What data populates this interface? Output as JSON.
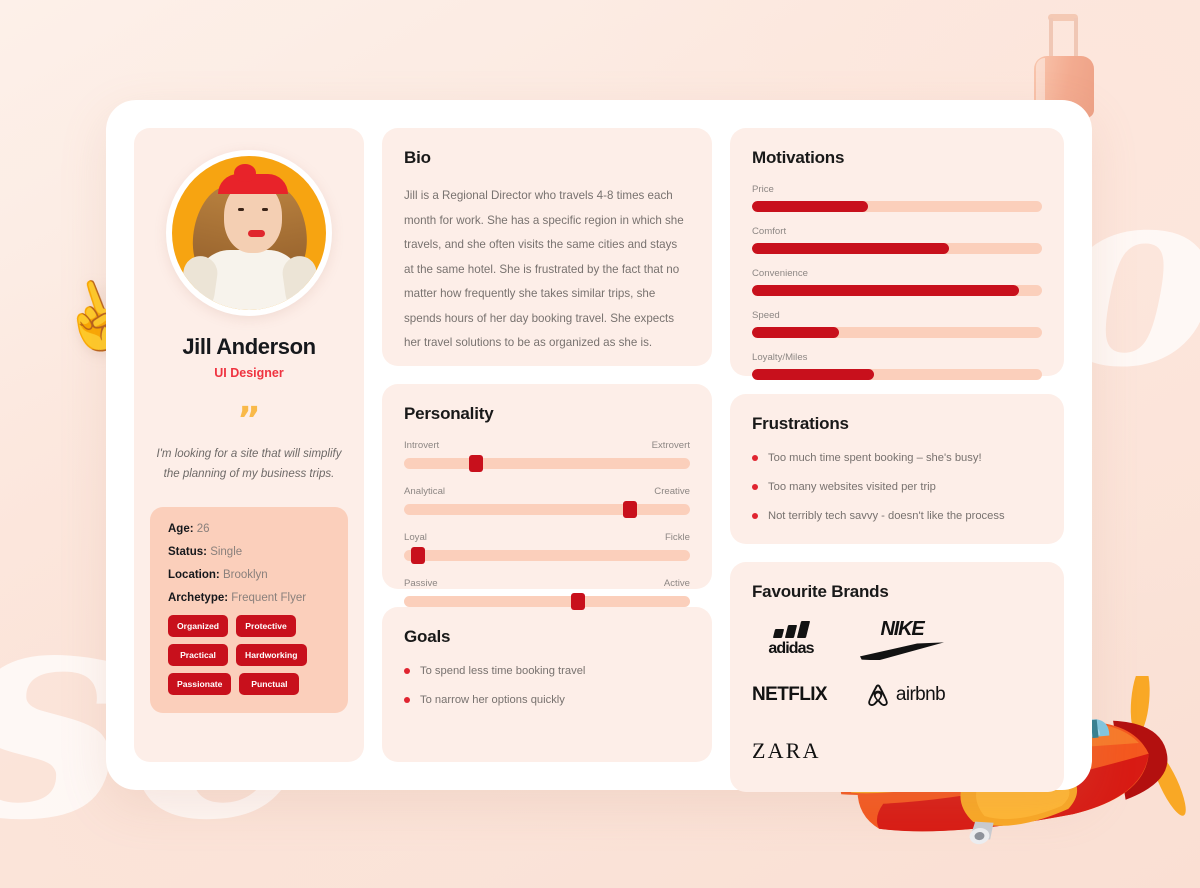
{
  "profile": {
    "name": "Jill Anderson",
    "role": "UI Designer",
    "quote_mark": "”",
    "quote": "I'm looking for a site that will simplify the planning of my business trips.",
    "facts": [
      {
        "label": "Age:",
        "value": "26"
      },
      {
        "label": "Status:",
        "value": "Single"
      },
      {
        "label": "Location:",
        "value": "Brooklyn"
      },
      {
        "label": "Archetype:",
        "value": "Frequent Flyer"
      }
    ],
    "chips": [
      "Organized",
      "Protective",
      "Practical",
      "Hardworking",
      "Passionate",
      "Punctual"
    ]
  },
  "bio": {
    "title": "Bio",
    "text": "Jill is a Regional Director who travels 4-8 times each month for work. She has a specific region in which she travels, and she often visits the same cities and stays at the same hotel. She is frustrated by the fact that no matter how frequently she takes similar trips, she spends hours of her day booking travel. She expects her travel solutions to be as organized as she is."
  },
  "personality": {
    "title": "Personality",
    "sliders": [
      {
        "left": "Introvert",
        "right": "Extrovert",
        "value": 25
      },
      {
        "left": "Analytical",
        "right": "Creative",
        "value": 79
      },
      {
        "left": "Loyal",
        "right": "Fickle",
        "value": 5
      },
      {
        "left": "Passive",
        "right": "Active",
        "value": 61
      }
    ]
  },
  "goals": {
    "title": "Goals",
    "items": [
      "To spend less time booking travel",
      "To narrow her options quickly"
    ]
  },
  "motivations": {
    "title": "Motivations",
    "items": [
      {
        "label": "Price",
        "value": 40
      },
      {
        "label": "Comfort",
        "value": 68
      },
      {
        "label": "Convenience",
        "value": 92
      },
      {
        "label": "Speed",
        "value": 30
      },
      {
        "label": "Loyalty/Miles",
        "value": 42
      }
    ]
  },
  "frustrations": {
    "title": "Frustrations",
    "items": [
      "Too much time spent booking – she's busy!",
      "Too many websites visited per trip",
      "Not terribly tech savvy - doesn't like the process"
    ]
  },
  "brands": {
    "title": "Favourite Brands",
    "items": [
      "adidas",
      "NIKE",
      "NETFLIX",
      "airbnb",
      "ZARA"
    ]
  },
  "decor": {
    "hand_emoji": "✌️",
    "script_left": "se",
    "script_right": "o"
  },
  "colors": {
    "accent_red": "#c8101c",
    "role_red": "#ef3340",
    "panel_bg": "#fdeee8",
    "facts_bg": "#fbcfbb",
    "page_bg": "#fdeee6",
    "quote_amber": "#f9b949"
  }
}
